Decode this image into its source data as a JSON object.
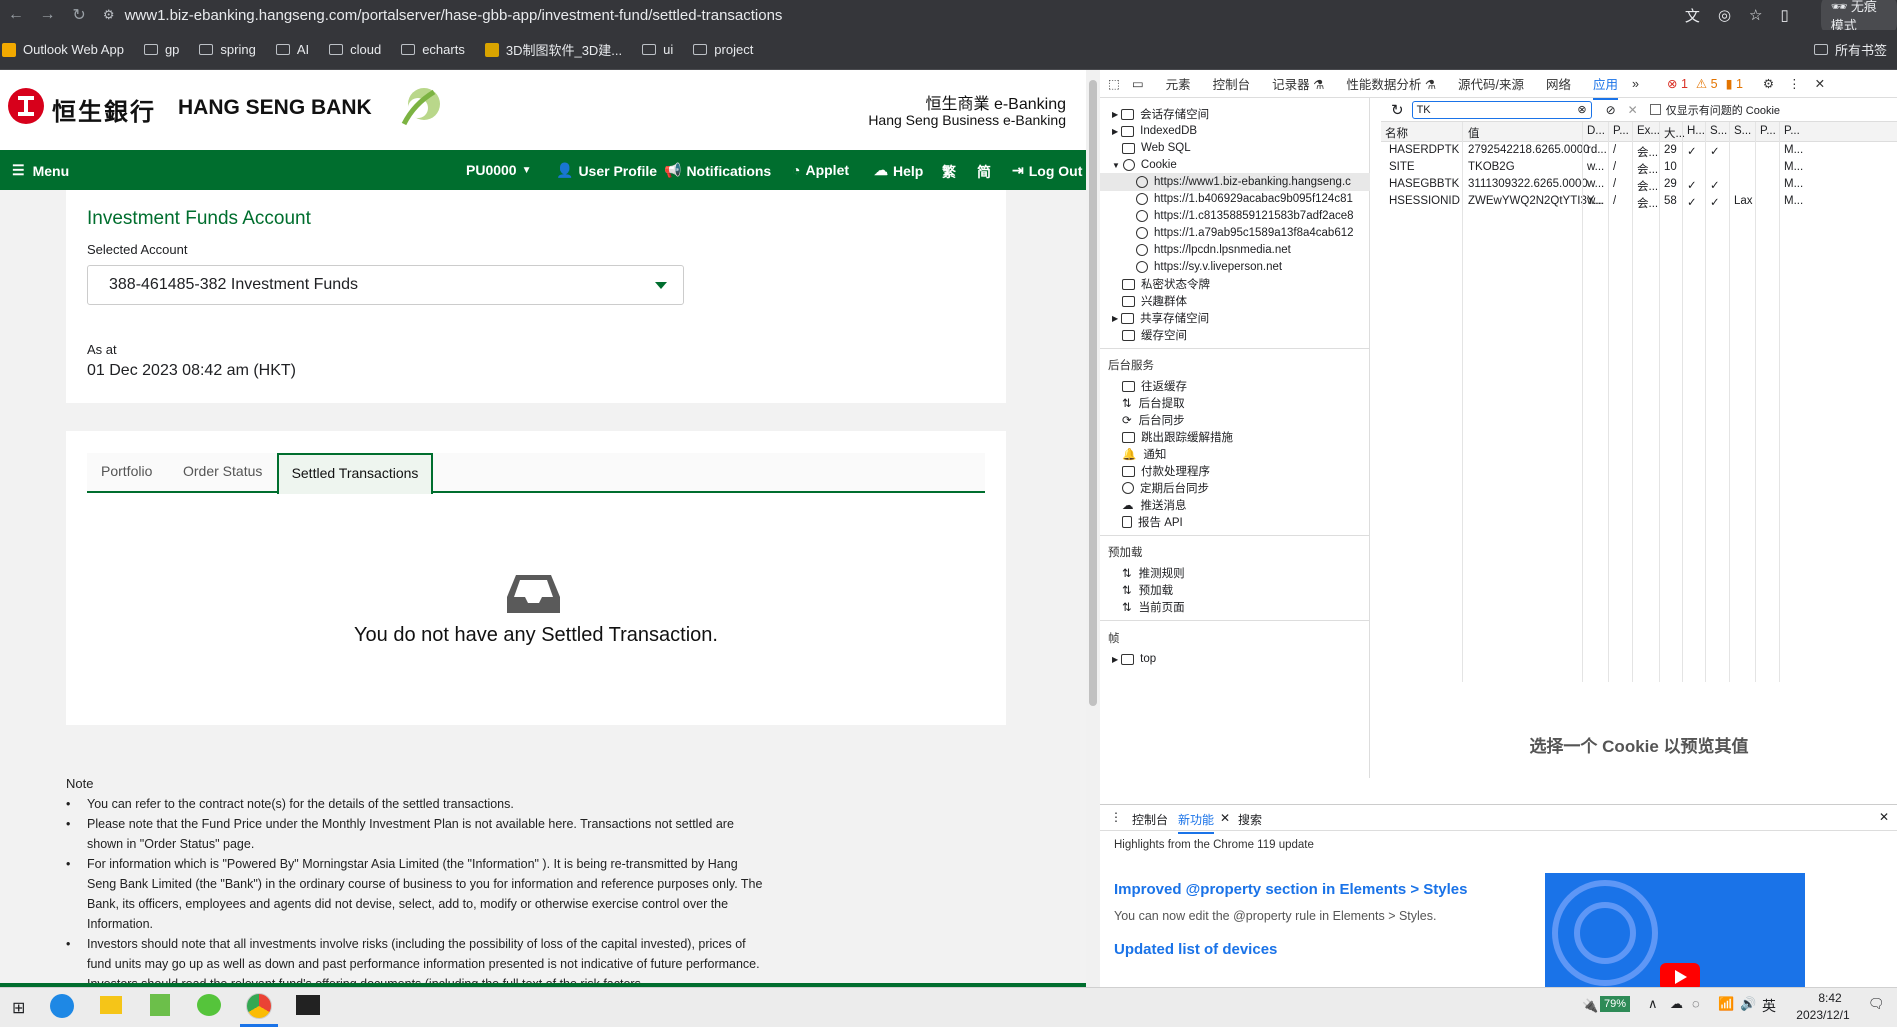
{
  "browser": {
    "url": "www1.biz-ebanking.hangseng.com/portalserver/hase-gbb-app/investment-fund/settled-transactions",
    "incognito_label": "无痕模式",
    "bookmarks": [
      "Outlook Web App",
      "gp",
      "spring",
      "AI",
      "cloud",
      "echarts",
      "3D制图软件_3D建...",
      "ui",
      "project"
    ],
    "all_bookmarks": "所有书签"
  },
  "bank": {
    "name_cn": "恒生銀行",
    "name_en": "HANG SENG BANK",
    "ebanking_cn": "恒生商業 e-Banking",
    "ebanking_en": "Hang Seng Business e-Banking",
    "brand_color": "#006e2e"
  },
  "menu": {
    "menu": "Menu",
    "account_code": "PU0000",
    "user_profile": "User Profile",
    "notifications": "Notifications",
    "applet": "Applet",
    "help": "Help",
    "lang_trad": "繁",
    "lang_simp": "简",
    "logout": "Log Out"
  },
  "account": {
    "title": "Investment Funds Account",
    "selected_label": "Selected Account",
    "selected_value": "388-461485-382 Investment Funds",
    "as_at_label": "As at",
    "as_at_value": "01 Dec 2023 08:42 am (HKT)"
  },
  "tabs": [
    "Portfolio",
    "Order Status",
    "Settled Transactions"
  ],
  "active_tab": "Settled Transactions",
  "empty_message": "You do not have any Settled Transaction.",
  "notes": {
    "title": "Note",
    "items": [
      "You can refer to the contract note(s) for the details of the settled transactions.",
      "Please note that the Fund Price under the Monthly Investment Plan is not available here. Transactions not settled are shown in \"Order Status\" page.",
      "For information which is \"Powered By\" Morningstar Asia Limited (the \"Information\" ). It is being re-transmitted by Hang Seng Bank Limited (the \"Bank\") in the ordinary course of business to you for information and reference purposes only. The Bank, its officers, employees and agents did not devise, select, add to, modify or otherwise exercise control over the Information.",
      "Investors should note that all investments involve risks (including the possibility of loss of the capital invested), prices of fund units may go up as well as down and past performance information presented is not indicative of future performance. Investors should read the relevant fund's offering documents (including the full text of the risk factors"
    ]
  },
  "devtools": {
    "tabs": [
      "元素",
      "控制台",
      "记录器 ⚗",
      "性能数据分析 ⚗",
      "源代码/来源",
      "网络",
      "应用"
    ],
    "active_tab": "应用",
    "counts": {
      "errors": "1",
      "warnings": "5",
      "info": "1"
    },
    "tree": [
      "会话存储空间",
      "IndexedDB",
      "Web SQL",
      "Cookie",
      "https://www1.biz-ebanking.hangseng.c",
      "https://1.b406929acabac9b095f124c81",
      "https://1.c81358859121583b7adf2ace8",
      "https://1.a79ab95c1589a13f8a4cab612",
      "https://lpcdn.lpsnmedia.net",
      "https://sy.v.liveperson.net",
      "私密状态令牌",
      "兴趣群体",
      "共享存储空间",
      "缓存空间"
    ],
    "section_backend": "后台服务",
    "backend": [
      "往返缓存",
      "后台提取",
      "后台同步",
      "跳出跟踪缓解措施",
      "通知",
      "付款处理程序",
      "定期后台同步",
      "推送消息",
      "报告 API"
    ],
    "section_preload": "预加载",
    "preload": [
      "推测规则",
      "预加载",
      "当前页面"
    ],
    "section_frames": "帧",
    "frames": [
      "top"
    ],
    "filter_value": "TK",
    "only_issues": "仅显示有问题的 Cookie",
    "columns": [
      "名称",
      "值",
      "D...",
      "P...",
      "Ex...",
      "大...",
      "H...",
      "S...",
      "S...",
      "P...",
      "P..."
    ],
    "cookies": [
      {
        "name": "HASERDPTK",
        "value": "2792542218.6265.0000",
        "domain": "rd...",
        "path": "/",
        "expires": "会...",
        "size": "29",
        "http": "✓",
        "secure": "✓",
        "samesite": "",
        "priority": "M..."
      },
      {
        "name": "SITE",
        "value": "TKOB2G",
        "domain": "w...",
        "path": "/",
        "expires": "会...",
        "size": "10",
        "http": "",
        "secure": "",
        "samesite": "",
        "priority": "M..."
      },
      {
        "name": "HASEGBBTK",
        "value": "3111309322.6265.0000",
        "domain": "w...",
        "path": "/",
        "expires": "会...",
        "size": "29",
        "http": "✓",
        "secure": "✓",
        "samesite": "",
        "priority": "M..."
      },
      {
        "name": "HSESSIONID",
        "value": "ZWEwYWQ2N2QtYTI3Y...",
        "domain": "w...",
        "path": "/",
        "expires": "会...",
        "size": "58",
        "http": "✓",
        "secure": "✓",
        "samesite": "Lax",
        "priority": "M..."
      }
    ],
    "preview_msg": "选择一个 Cookie 以预览其值",
    "drawer_tabs": [
      "控制台",
      "新功能",
      "搜索"
    ],
    "drawer_active": "新功能",
    "highlights": "Highlights from the Chrome 119 update",
    "feature1": "Improved @property section in Elements > Styles",
    "feature1_desc": "You can now edit the @property rule in Elements > Styles.",
    "feature2": "Updated list of devices"
  },
  "taskbar": {
    "battery": "79%",
    "ime": "英",
    "time": "8:42",
    "date": "2023/12/1"
  }
}
